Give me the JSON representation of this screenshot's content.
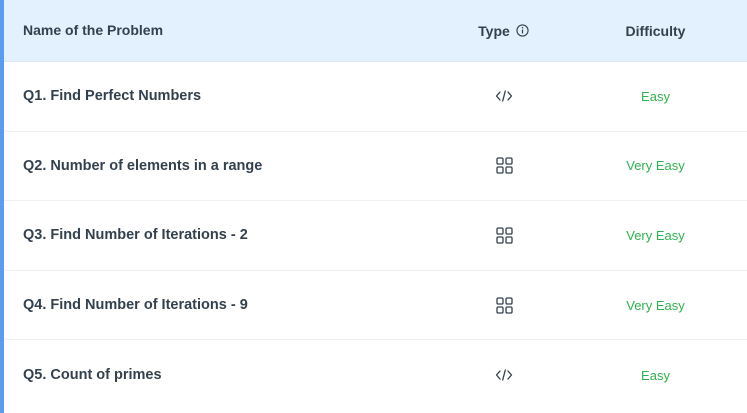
{
  "header": {
    "name_label": "Name of the Problem",
    "type_label": "Type",
    "difficulty_label": "Difficulty",
    "info_icon": "info-circle-icon"
  },
  "colors": {
    "accent_border": "#5b9bf2",
    "header_bg": "#e3f0fd",
    "difficulty_green": "#2eb34f",
    "text_dark": "#33414e"
  },
  "problems": [
    {
      "name": "Q1. Find Perfect Numbers",
      "type": "code",
      "type_icon": "code-icon",
      "difficulty": "Easy"
    },
    {
      "name": "Q2. Number of elements in a range",
      "type": "grid",
      "type_icon": "grid-icon",
      "difficulty": "Very Easy"
    },
    {
      "name": "Q3. Find Number of Iterations - 2",
      "type": "grid",
      "type_icon": "grid-icon",
      "difficulty": "Very Easy"
    },
    {
      "name": "Q4. Find Number of Iterations - 9",
      "type": "grid",
      "type_icon": "grid-icon",
      "difficulty": "Very Easy"
    },
    {
      "name": "Q5. Count of primes",
      "type": "code",
      "type_icon": "code-icon",
      "difficulty": "Easy"
    }
  ]
}
